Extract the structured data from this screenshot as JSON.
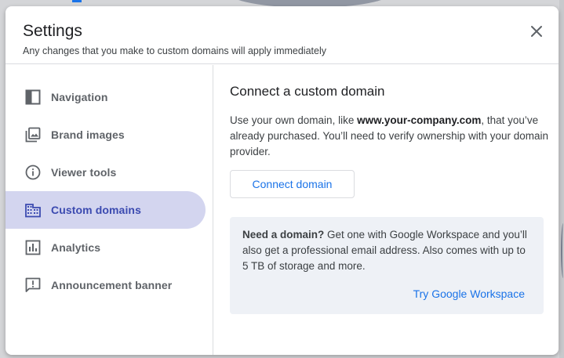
{
  "dialog": {
    "title": "Settings",
    "subtitle": "Any changes that you make to custom domains will apply immediately",
    "close_icon": "close-icon"
  },
  "sidebar": {
    "items": [
      {
        "label": "Navigation",
        "icon": "navigation-icon",
        "active": false
      },
      {
        "label": "Brand images",
        "icon": "brand-images-icon",
        "active": false
      },
      {
        "label": "Viewer tools",
        "icon": "info-icon",
        "active": false
      },
      {
        "label": "Custom domains",
        "icon": "domain-icon",
        "active": true
      },
      {
        "label": "Analytics",
        "icon": "analytics-icon",
        "active": false
      },
      {
        "label": "Announcement banner",
        "icon": "announcement-icon",
        "active": false
      }
    ]
  },
  "main": {
    "title": "Connect a custom domain",
    "desc_before": "Use your own domain, like ",
    "desc_domain": "www.your-company.com",
    "desc_after": ", that you’ve already purchased. You’ll need to verify ownership with your domain provider.",
    "connect_button": "Connect domain",
    "info_bold": "Need a domain?",
    "info_text": " Get one with Google Workspace and you’ll also get a professional email address. Also comes with up to 5 TB of storage and more.",
    "info_link": "Try Google Workspace"
  },
  "colors": {
    "accent": "#1a73e8",
    "active_bg": "#d3d5ef",
    "active_text": "#3b4ab0",
    "info_bg": "#eef1f6"
  }
}
